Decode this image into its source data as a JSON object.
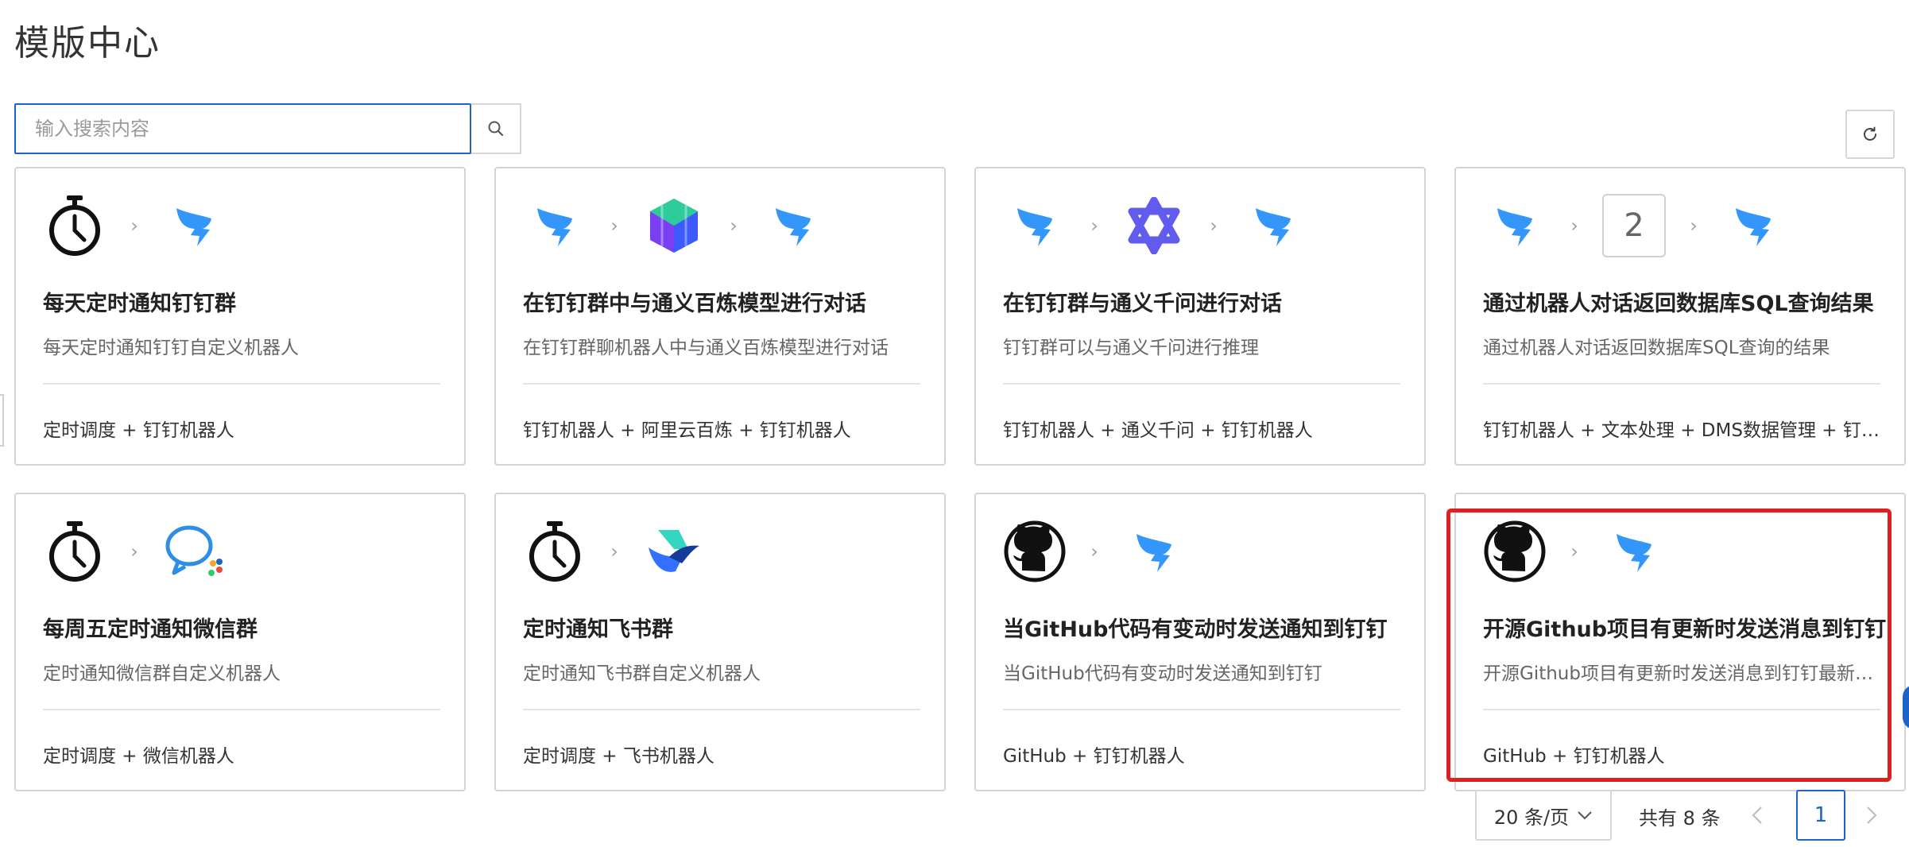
{
  "page": {
    "title": "模版中心"
  },
  "search": {
    "placeholder": "输入搜索内容"
  },
  "cards": [
    {
      "icons": [
        "stopwatch-icon",
        "dingtalk-icon"
      ],
      "title": "每天定时通知钉钉群",
      "desc": "每天定时通知钉钉自定义机器人",
      "tags": "定时调度 + 钉钉机器人"
    },
    {
      "icons": [
        "dingtalk-icon",
        "bailian-icon",
        "dingtalk-icon"
      ],
      "title": "在钉钉群中与通义百炼模型进行对话",
      "desc": "在钉钉群聊机器人中与通义百炼模型进行对话",
      "tags": "钉钉机器人 + 阿里云百炼 + 钉钉机器人"
    },
    {
      "icons": [
        "dingtalk-icon",
        "qwen-icon",
        "dingtalk-icon"
      ],
      "title": "在钉钉群与通义千问进行对话",
      "desc": "钉钉群可以与通义千问进行推理",
      "tags": "钉钉机器人 + 通义千问 + 钉钉机器人"
    },
    {
      "icons": [
        "dingtalk-icon",
        "number-icon",
        "dingtalk-icon"
      ],
      "number": "2",
      "title": "通过机器人对话返回数据库SQL查询结果",
      "desc": "通过机器人对话返回数据库SQL查询的结果",
      "tags": "钉钉机器人 + 文本处理 + DMS数据管理 + 钉钉机器人"
    },
    {
      "icons": [
        "stopwatch-icon",
        "wechat-work-icon"
      ],
      "title": "每周五定时通知微信群",
      "desc": "定时通知微信群自定义机器人",
      "tags": "定时调度 + 微信机器人"
    },
    {
      "icons": [
        "stopwatch-icon",
        "feishu-icon"
      ],
      "title": "定时通知飞书群",
      "desc": "定时通知飞书群自定义机器人",
      "tags": "定时调度 + 飞书机器人"
    },
    {
      "icons": [
        "github-icon",
        "dingtalk-icon"
      ],
      "title": "当GitHub代码有变动时发送通知到钉钉",
      "desc": "当GitHub代码有变动时发送通知到钉钉",
      "tags": "GitHub + 钉钉机器人"
    },
    {
      "icons": [
        "github-icon",
        "dingtalk-icon"
      ],
      "title": "开源Github项目有更新时发送消息到钉钉",
      "desc": "开源Github项目有更新时发送消息到钉钉最新动态",
      "tags": "GitHub + 钉钉机器人"
    }
  ],
  "pagination": {
    "page_size": "20 条/页",
    "total": "共有 8 条",
    "current_page": "1"
  },
  "colors": {
    "primary": "#1d64c8",
    "highlight": "#e02020",
    "border": "#d4d4d4"
  }
}
